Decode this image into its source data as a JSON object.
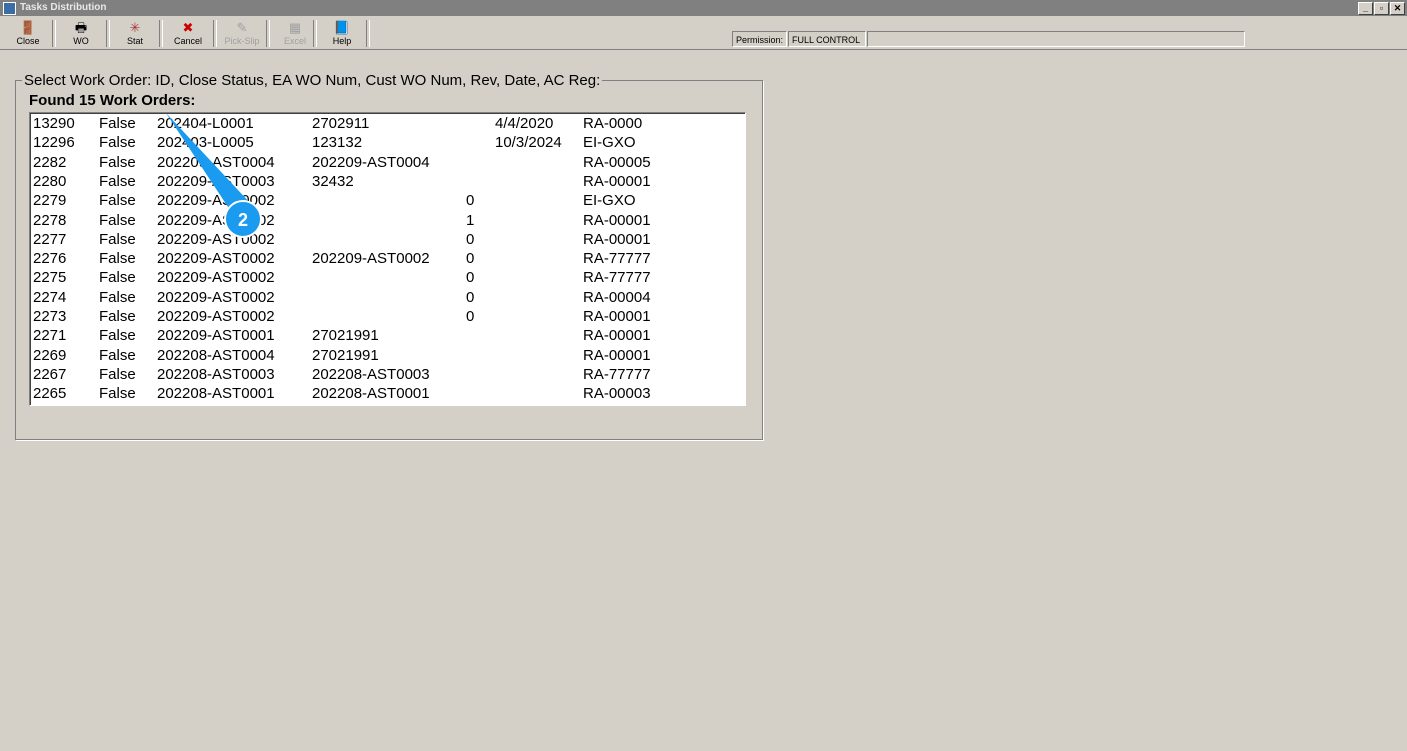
{
  "window": {
    "title": "Tasks Distribution",
    "controls": [
      "_",
      "▫",
      "✕"
    ]
  },
  "toolbar": [
    {
      "label": "Close",
      "icon": "exit-door-icon",
      "glyph": "🚪",
      "enabled": true
    },
    {
      "label": "WO",
      "icon": "printer-icon",
      "glyph": "🖶",
      "enabled": true
    },
    {
      "label": "Stat",
      "icon": "stat-burst-icon",
      "glyph": "✳",
      "enabled": true
    },
    {
      "label": "Cancel",
      "icon": "red-x-icon",
      "glyph": "✖",
      "enabled": true
    },
    {
      "label": "Pick-Slip",
      "icon": "pick-slip-icon",
      "glyph": "✎",
      "enabled": false
    },
    {
      "label": "Excel",
      "icon": "excel-icon",
      "glyph": "▦",
      "enabled": false
    },
    {
      "label": "Help",
      "icon": "help-book-icon",
      "glyph": "📘",
      "enabled": true
    }
  ],
  "permission": {
    "label": "Permission:",
    "value": "FULL CONTROL"
  },
  "group_label": "Select Work Order: ID, Close Status, EA WO Num, Cust WO Num, Rev, Date, AC Reg:",
  "found_label": "Found 15 Work Orders:",
  "rows": [
    [
      "13290",
      "False",
      "202404-L0001",
      "2702911",
      "",
      "4/4/2020",
      "RA-0000"
    ],
    [
      "12296",
      "False",
      "202403-L0005",
      "123132",
      "",
      "10/3/2024",
      "EI-GXO"
    ],
    [
      "2282",
      "False",
      "202209-AST0004",
      "202209-AST0004",
      "",
      "",
      "RA-00005"
    ],
    [
      "2280",
      "False",
      "202209-AST0003",
      "32432",
      "",
      "",
      "RA-00001"
    ],
    [
      "2279",
      "False",
      "202209-AST0002",
      "",
      "0",
      "",
      "EI-GXO"
    ],
    [
      "2278",
      "False",
      "202209-AST0002",
      "",
      "1",
      "",
      "RA-00001"
    ],
    [
      "2277",
      "False",
      "202209-AST0002",
      "",
      "0",
      "",
      "RA-00001"
    ],
    [
      "2276",
      "False",
      "202209-AST0002",
      "202209-AST0002",
      "0",
      "",
      "RA-77777"
    ],
    [
      "2275",
      "False",
      "202209-AST0002",
      "",
      "0",
      "",
      "RA-77777"
    ],
    [
      "2274",
      "False",
      "202209-AST0002",
      "",
      "0",
      "",
      "RA-00004"
    ],
    [
      "2273",
      "False",
      "202209-AST0002",
      "",
      "0",
      "",
      "RA-00001"
    ],
    [
      "2271",
      "False",
      "202209-AST0001",
      "27021991",
      "",
      "",
      "RA-00001"
    ],
    [
      "2269",
      "False",
      "202208-AST0004",
      "27021991",
      "",
      "",
      "RA-00001"
    ],
    [
      "2267",
      "False",
      "202208-AST0003",
      "202208-AST0003",
      "",
      "",
      "RA-77777"
    ],
    [
      "2265",
      "False",
      "202208-AST0001",
      "202208-AST0001",
      "",
      "",
      "RA-00003"
    ]
  ],
  "callout": {
    "number": "2",
    "color": "#1a9bf0"
  }
}
